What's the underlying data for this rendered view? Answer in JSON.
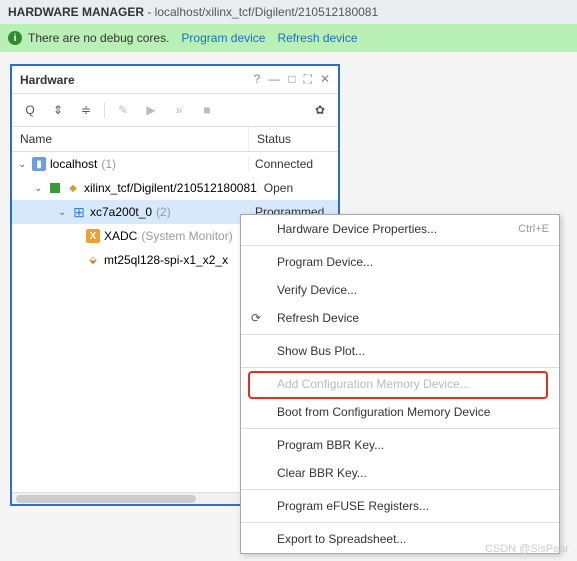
{
  "header": {
    "title": "HARDWARE MANAGER",
    "path": " - localhost/xilinx_tcf/Digilent/210512180081"
  },
  "banner": {
    "msg": "There are no debug cores.",
    "link1": "Program device",
    "link2": "Refresh device"
  },
  "panel": {
    "title": "Hardware"
  },
  "cols": {
    "name": "Name",
    "status": "Status"
  },
  "tree": {
    "r0": {
      "label": "localhost",
      "count": "(1)",
      "status": "Connected"
    },
    "r1": {
      "label": "xilinx_tcf/Digilent/210512180081",
      "status": "Open"
    },
    "r2": {
      "label": "xc7a200t_0",
      "count": "(2)",
      "status": "Programmed"
    },
    "r3": {
      "label": "XADC",
      "hint": "(System Monitor)"
    },
    "r4": {
      "label": "mt25ql128-spi-x1_x2_x"
    }
  },
  "menu": {
    "m0": {
      "label": "Hardware Device Properties...",
      "sc": "Ctrl+E"
    },
    "m1": {
      "label": "Program Device..."
    },
    "m2": {
      "label": "Verify Device..."
    },
    "m3": {
      "label": "Refresh Device"
    },
    "m4": {
      "label": "Show Bus Plot..."
    },
    "m5": {
      "label": "Add Configuration Memory Device..."
    },
    "m6": {
      "label": "Boot from Configuration Memory Device"
    },
    "m7": {
      "label": "Program BBR Key..."
    },
    "m8": {
      "label": "Clear BBR Key..."
    },
    "m9": {
      "label": "Program eFUSE Registers..."
    },
    "m10": {
      "label": "Export to Spreadsheet..."
    }
  },
  "watermark": "CSDN @SisPear"
}
